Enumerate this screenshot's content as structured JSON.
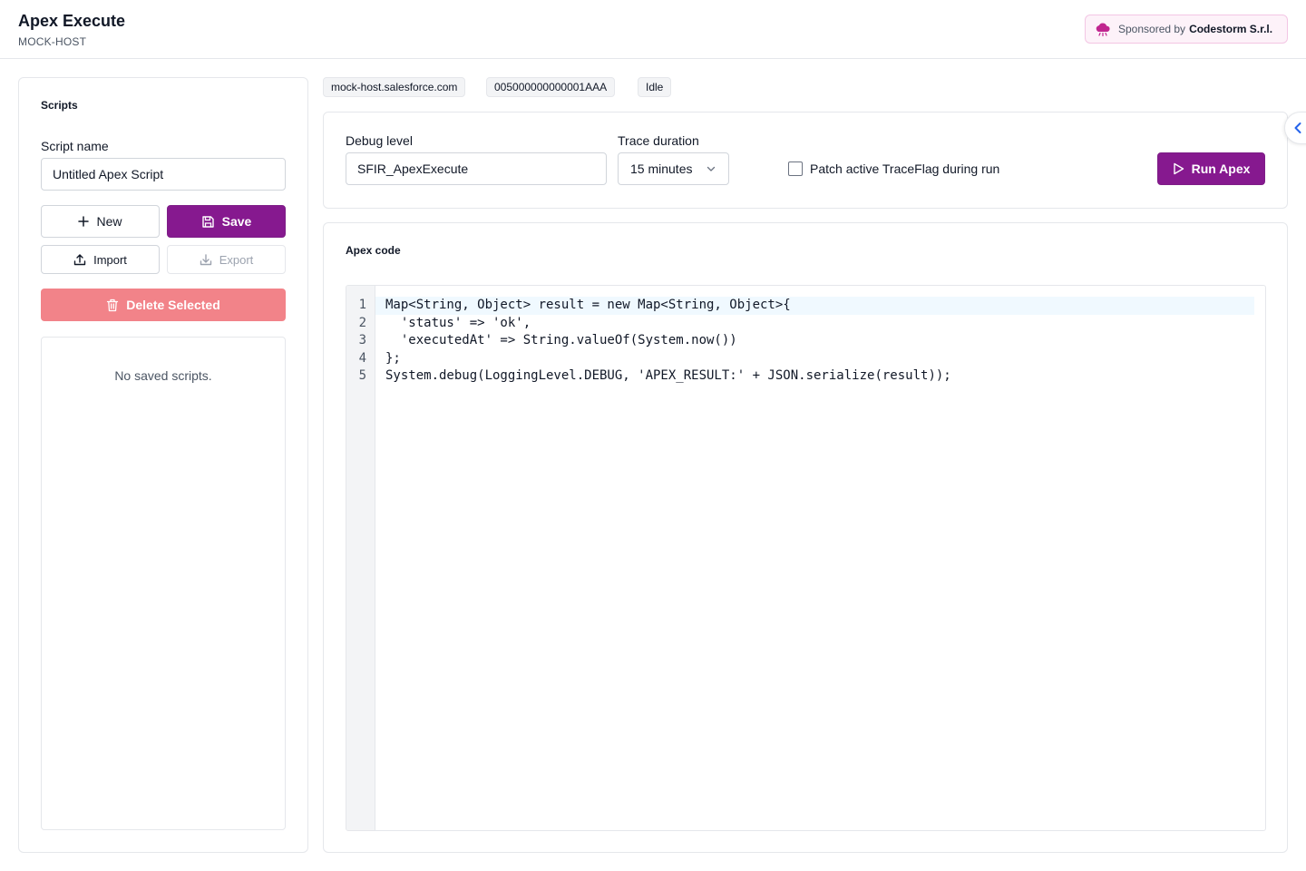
{
  "header": {
    "title": "Apex Execute",
    "subtitle": "MOCK-HOST",
    "sponsor": {
      "prefix": "Sponsored by",
      "company": "Codestorm S.r.l.",
      "icon": "cloud-icon"
    }
  },
  "scripts_panel": {
    "heading": "Scripts",
    "script_name_label": "Script name",
    "script_name_value": "Untitled Apex Script",
    "new_label": "New",
    "save_label": "Save",
    "import_label": "Import",
    "export_label": "Export",
    "delete_label": "Delete Selected",
    "empty_message": "No saved scripts."
  },
  "status": {
    "host": "mock-host.salesforce.com",
    "user_id": "005000000000001AAA",
    "state": "Idle"
  },
  "settings": {
    "debug_level_label": "Debug level",
    "debug_level_value": "SFIR_ApexExecute",
    "trace_duration_label": "Trace duration",
    "trace_duration_value": "15 minutes",
    "patch_traceflag_label": "Patch active TraceFlag during run",
    "patch_traceflag_checked": false,
    "run_label": "Run Apex"
  },
  "editor": {
    "heading": "Apex code",
    "lines": [
      {
        "num": "1",
        "text": "Map<String, Object> result = new Map<String, Object>{"
      },
      {
        "num": "2",
        "text": "  'status' => 'ok',"
      },
      {
        "num": "3",
        "text": "  'executedAt' => String.valueOf(System.now())"
      },
      {
        "num": "4",
        "text": "};"
      },
      {
        "num": "5",
        "text": "System.debug(LoggingLevel.DEBUG, 'APEX_RESULT:' + JSON.serialize(result));"
      }
    ]
  },
  "colors": {
    "primary": "#86198f",
    "danger_disabled": "#f28389",
    "sponsor_bg": "#fdf2f9",
    "collapse_icon": "#2563eb"
  }
}
